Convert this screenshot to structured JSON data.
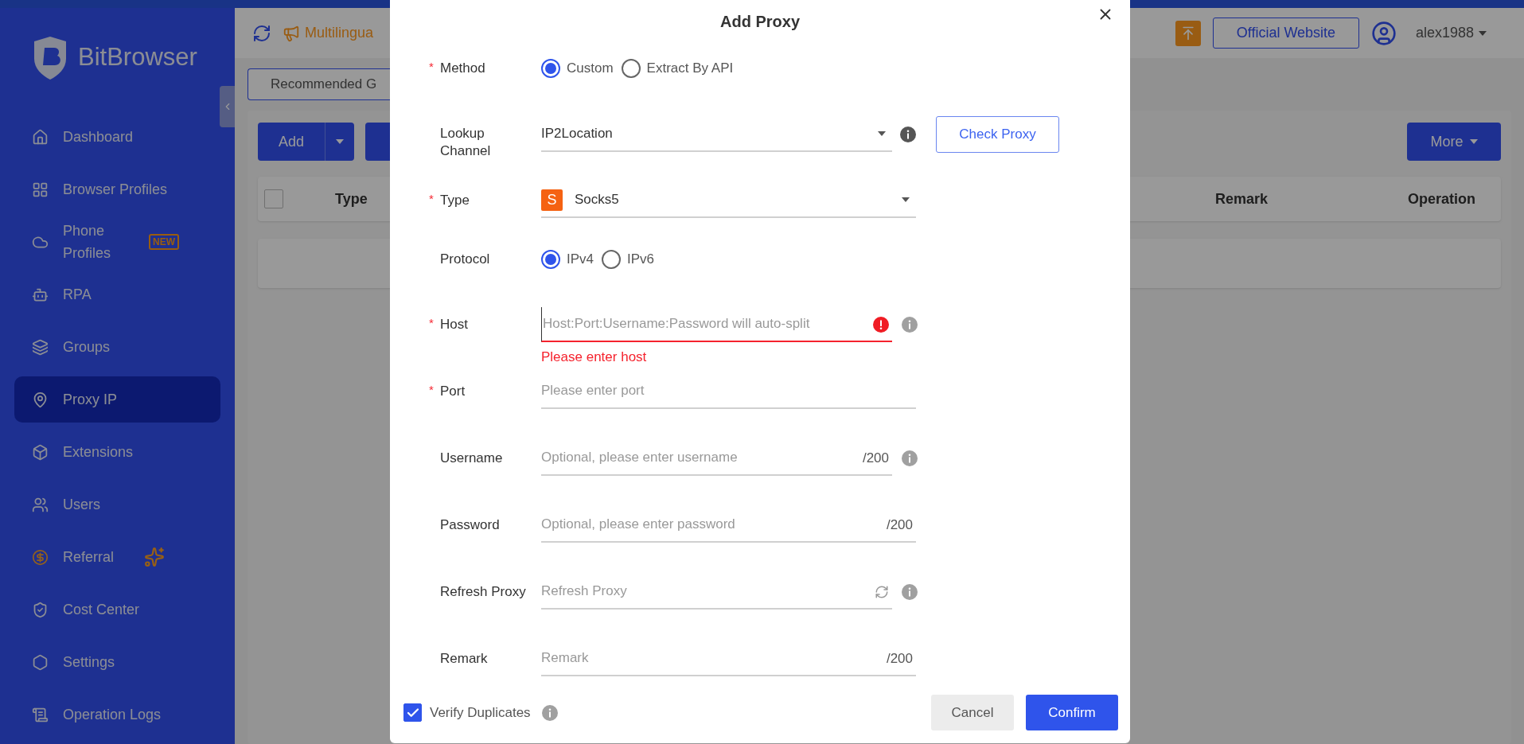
{
  "sidebar": {
    "brand": "BitBrowser",
    "items": [
      {
        "label": "Dashboard",
        "selected": false
      },
      {
        "label": "Browser Profiles",
        "selected": false
      },
      {
        "label": "Phone Profiles",
        "badge": "NEW",
        "selected": false
      },
      {
        "label": "RPA",
        "selected": false
      },
      {
        "label": "Groups",
        "selected": false
      },
      {
        "label": "Proxy IP",
        "selected": true
      },
      {
        "label": "Extensions",
        "selected": false
      },
      {
        "label": "Users",
        "selected": false
      },
      {
        "label": "Referral",
        "selected": false
      },
      {
        "label": "Cost Center",
        "selected": false
      },
      {
        "label": "Settings",
        "selected": false
      },
      {
        "label": "Operation Logs",
        "selected": false
      }
    ]
  },
  "header": {
    "announcement": "Multilingua",
    "official_website": "Official Website",
    "user": "alex1988"
  },
  "tabs": [
    {
      "label": "Recommended G",
      "selected": false
    }
  ],
  "toolbar": {
    "add": "Add",
    "more": "More"
  },
  "table": {
    "columns": [
      "Type",
      "Remark",
      "Operation"
    ],
    "select_all_checked": false
  },
  "dialog": {
    "title": "Add Proxy",
    "rows": [
      {
        "kind": "radio",
        "label": "Method",
        "required_mark": "*",
        "options": [
          {
            "label": "Custom",
            "selected": true
          },
          {
            "label": "Extract By API",
            "selected": false
          }
        ]
      },
      {
        "kind": "select",
        "label": "Lookup Channel",
        "value": "IP2Location",
        "info": true,
        "action": "Check Proxy"
      },
      {
        "kind": "select",
        "label": "Type",
        "required_mark": "*",
        "value": "Socks5",
        "badge": "S"
      },
      {
        "kind": "radio",
        "label": "Protocol",
        "options": [
          {
            "label": "IPv4",
            "selected": true
          },
          {
            "label": "IPv6",
            "selected": false
          }
        ]
      },
      {
        "kind": "input",
        "label": "Host",
        "required_mark": "*",
        "placeholder": "Host:Port:Username:Password will auto-split",
        "error": "Please enter host",
        "info": true
      },
      {
        "kind": "input",
        "label": "Port",
        "required_mark": "*",
        "placeholder": "Please enter port"
      },
      {
        "kind": "input",
        "label": "Username",
        "placeholder": "Optional, please enter username",
        "counter": "/200",
        "info": true
      },
      {
        "kind": "input",
        "label": "Password",
        "placeholder": "Optional, please enter password",
        "counter": "/200"
      },
      {
        "kind": "refresh-input",
        "label": "Refresh Proxy",
        "placeholder": "Refresh Proxy",
        "info": true
      },
      {
        "kind": "input",
        "label": "Remark",
        "placeholder": "Remark",
        "counter": "/200"
      }
    ],
    "verify": {
      "label": "Verify Duplicates",
      "checked": true
    },
    "cancel": "Cancel",
    "confirm": "Confirm"
  }
}
